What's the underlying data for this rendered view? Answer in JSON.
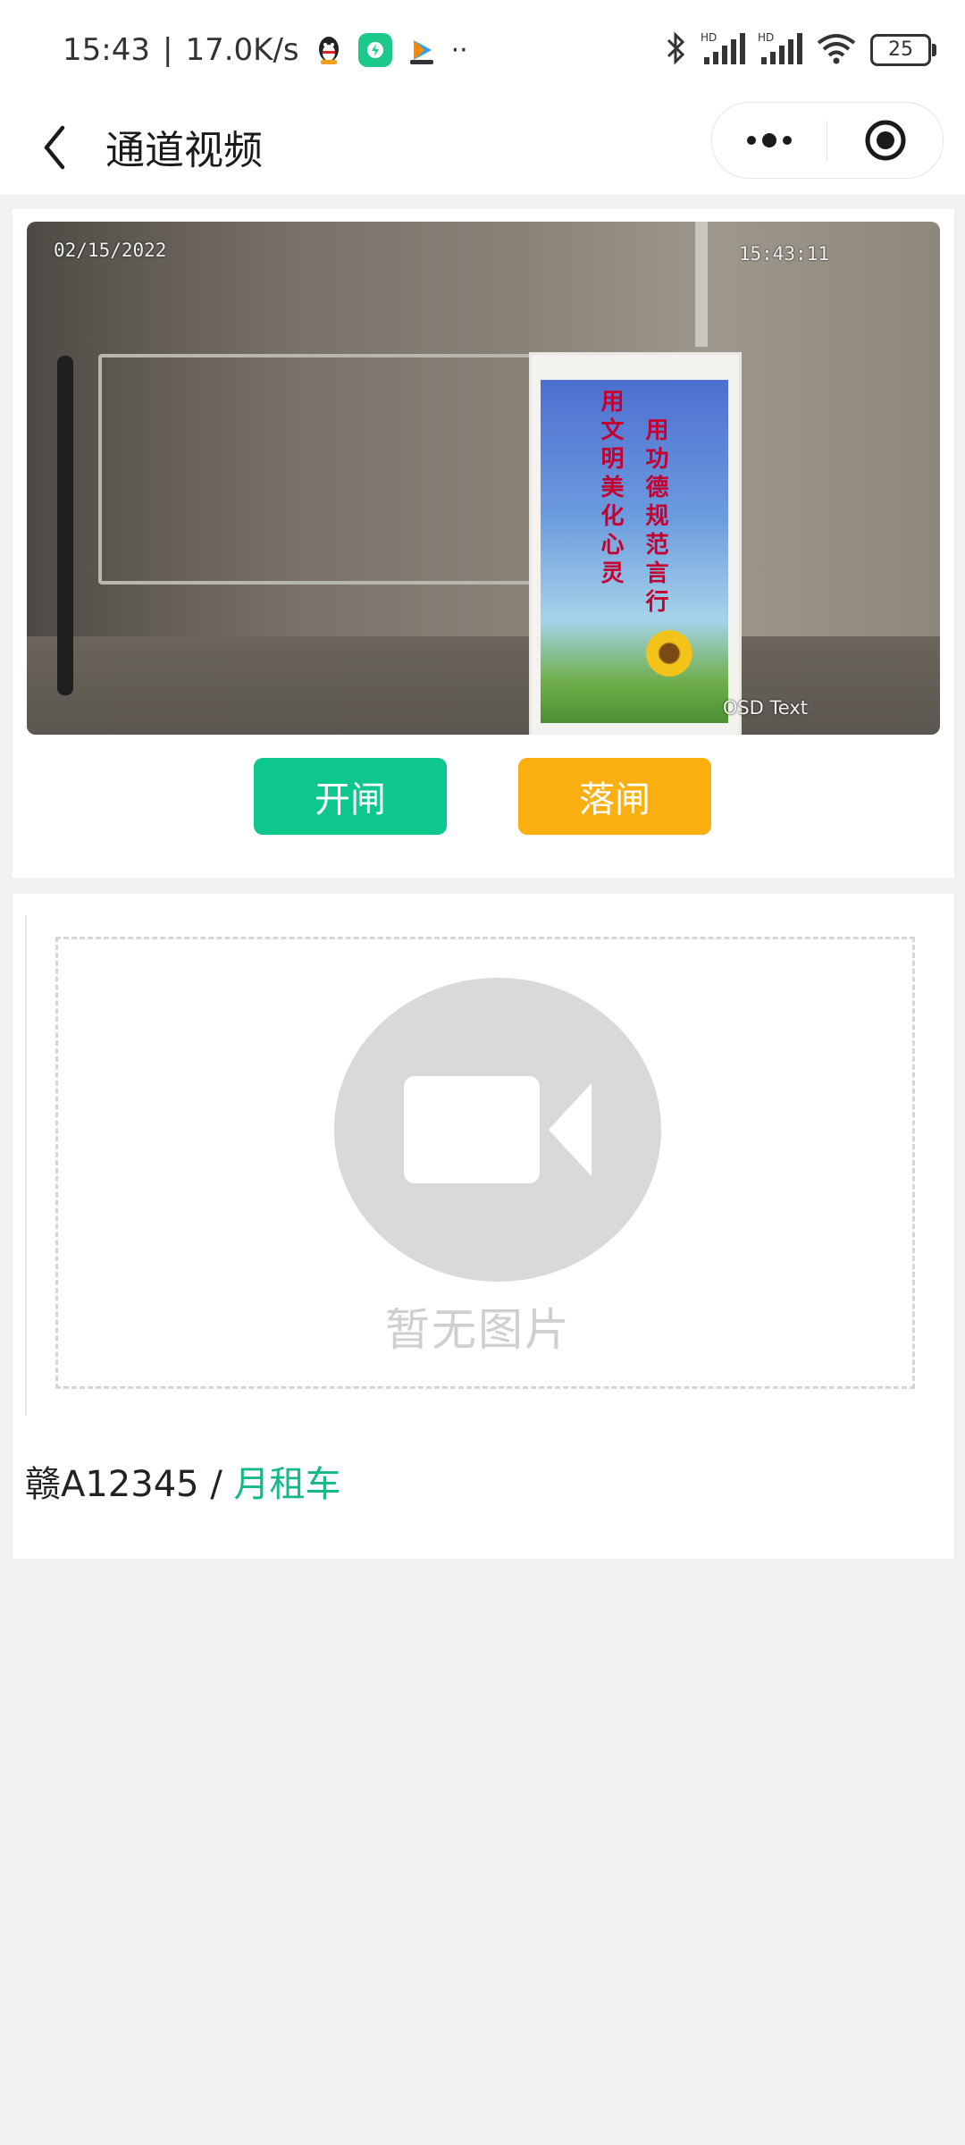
{
  "status_bar": {
    "time": "15:43",
    "speed": "17.0K/s",
    "battery": "25"
  },
  "nav": {
    "title": "通道视频"
  },
  "video": {
    "osd_date": "02/15/2022",
    "osd_time": "15:43:11",
    "osd_text": "OSD Text",
    "poster_line1": "用文明美化心灵",
    "poster_line2": "用功德规范言行"
  },
  "controls": {
    "open_label": "开闸",
    "close_label": "落闸"
  },
  "snapshot": {
    "empty_label": "暂无图片",
    "plate": "赣A12345",
    "separator": " / ",
    "vehicle_type": "月租车"
  },
  "colors": {
    "open_button": "#0ec78c",
    "close_button": "#fcaf10",
    "accent_text": "#14b88a"
  }
}
